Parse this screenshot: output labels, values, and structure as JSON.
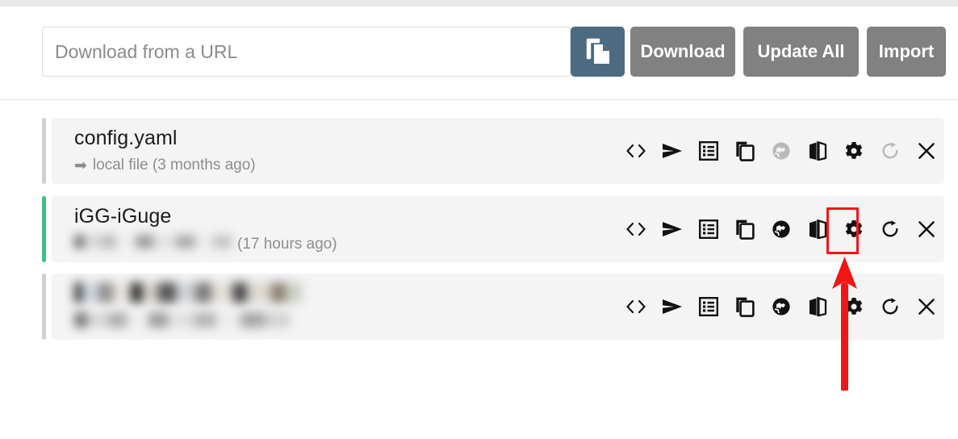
{
  "header": {
    "url_input": {
      "placeholder": "Download from a URL",
      "value": ""
    },
    "paste_button": {
      "label": "",
      "icon": "paste-icon",
      "color": "#4c6b81"
    },
    "buttons": [
      {
        "label": "Download",
        "name": "download-button"
      },
      {
        "label": "Update All",
        "name": "update-all-button"
      },
      {
        "label": "Import",
        "name": "import-button"
      }
    ],
    "button_color": "#828181"
  },
  "list": {
    "rows": [
      {
        "title": "config.yaml",
        "subtitle_arrow": "➡",
        "subtitle": "local file (3 months ago)",
        "subtitle_redacted": "",
        "timestamp": "(3 months ago)",
        "accent_color": "#d0d0d0",
        "redacted": false,
        "title_redacted": false,
        "icons": [
          {
            "name": "code-icon",
            "state": "active"
          },
          {
            "name": "send-icon",
            "state": "active"
          },
          {
            "name": "list-icon",
            "state": "active"
          },
          {
            "name": "copy-icon",
            "state": "active"
          },
          {
            "name": "globe-icon",
            "state": "disabled"
          },
          {
            "name": "translate-icon",
            "state": "active"
          },
          {
            "name": "gear-icon",
            "state": "active"
          },
          {
            "name": "refresh-icon",
            "state": "disabled"
          },
          {
            "name": "close-icon",
            "state": "active"
          }
        ]
      },
      {
        "title": "iGG-iGuge",
        "subtitle_arrow": "➡",
        "subtitle": "",
        "subtitle_redacted": "https://example.redacted.url/path",
        "timestamp": "(17 hours ago)",
        "accent_color": "#3ec27f",
        "redacted": true,
        "title_redacted": false,
        "icons": [
          {
            "name": "code-icon",
            "state": "active"
          },
          {
            "name": "send-icon",
            "state": "active"
          },
          {
            "name": "list-icon",
            "state": "active"
          },
          {
            "name": "copy-icon",
            "state": "active"
          },
          {
            "name": "globe-icon",
            "state": "active"
          },
          {
            "name": "translate-icon",
            "state": "active"
          },
          {
            "name": "gear-icon",
            "state": "active"
          },
          {
            "name": "refresh-icon",
            "state": "active"
          },
          {
            "name": "close-icon",
            "state": "active"
          }
        ]
      },
      {
        "title": "",
        "title_redacted_text": "ipv4 Rule 101 107 108 redacted",
        "subtitle_arrow": "➡",
        "subtitle": "",
        "subtitle_redacted": "site redacted value",
        "timestamp": "s ago)",
        "accent_color": "#d0d0d0",
        "redacted": true,
        "title_redacted": true,
        "icons": [
          {
            "name": "code-icon",
            "state": "active"
          },
          {
            "name": "send-icon",
            "state": "active"
          },
          {
            "name": "list-icon",
            "state": "active"
          },
          {
            "name": "copy-icon",
            "state": "active"
          },
          {
            "name": "globe-icon",
            "state": "active"
          },
          {
            "name": "translate-icon",
            "state": "active"
          },
          {
            "name": "gear-icon",
            "state": "active"
          },
          {
            "name": "refresh-icon",
            "state": "active"
          },
          {
            "name": "close-icon",
            "state": "active"
          }
        ]
      }
    ]
  },
  "annotation": {
    "highlight_color": "#f21616",
    "highlight_target": "gear-icon-row-2",
    "arrow_direction": "up",
    "arrow_color": "#f21616"
  }
}
